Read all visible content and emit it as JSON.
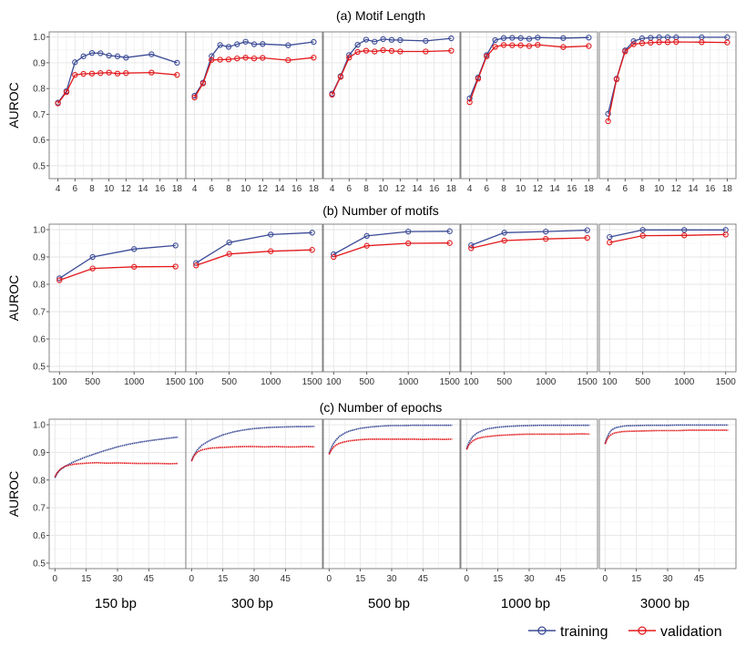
{
  "colors": {
    "training": "#3b4b96",
    "validation": "#e3191c",
    "grid": "#e6e6e6",
    "frame": "#777777"
  },
  "legend": {
    "training": "training",
    "validation": "validation"
  },
  "group_labels": [
    "150 bp",
    "300 bp",
    "500 bp",
    "1000 bp",
    "3000 bp"
  ],
  "chart_data": [
    {
      "type": "line",
      "title": "(a)  Motif Length",
      "ylabel": "AUROC",
      "ylim": [
        0.45,
        1.02
      ],
      "yticks": [
        0.5,
        0.6,
        0.7,
        0.8,
        0.9,
        1.0
      ],
      "xlim": [
        3.4,
        18.6
      ],
      "xticks": [
        4,
        6,
        8,
        10,
        12,
        14,
        16,
        18
      ],
      "markers": true,
      "facets": [
        {
          "x": [
            4,
            5,
            6,
            7,
            8,
            9,
            10,
            11,
            12,
            15,
            18
          ],
          "training": [
            0.745,
            0.79,
            0.902,
            0.925,
            0.938,
            0.937,
            0.928,
            0.925,
            0.92,
            0.933,
            0.9
          ],
          "validation": [
            0.742,
            0.786,
            0.853,
            0.857,
            0.858,
            0.86,
            0.862,
            0.858,
            0.86,
            0.862,
            0.853
          ]
        },
        {
          "x": [
            4,
            5,
            6,
            7,
            8,
            9,
            10,
            11,
            12,
            15,
            18
          ],
          "training": [
            0.772,
            0.823,
            0.926,
            0.969,
            0.962,
            0.972,
            0.982,
            0.972,
            0.973,
            0.968,
            0.981
          ],
          "validation": [
            0.765,
            0.82,
            0.911,
            0.912,
            0.913,
            0.917,
            0.92,
            0.917,
            0.919,
            0.91,
            0.92
          ]
        },
        {
          "x": [
            4,
            5,
            6,
            7,
            8,
            9,
            10,
            11,
            12,
            15,
            18
          ],
          "training": [
            0.78,
            0.848,
            0.93,
            0.97,
            0.99,
            0.982,
            0.992,
            0.989,
            0.988,
            0.985,
            0.995
          ],
          "validation": [
            0.776,
            0.845,
            0.92,
            0.942,
            0.947,
            0.944,
            0.949,
            0.946,
            0.944,
            0.944,
            0.947
          ]
        },
        {
          "x": [
            4,
            5,
            6,
            7,
            8,
            9,
            10,
            11,
            12,
            15,
            18
          ],
          "training": [
            0.762,
            0.843,
            0.93,
            0.988,
            0.996,
            0.997,
            0.996,
            0.993,
            0.998,
            0.996,
            0.998
          ],
          "validation": [
            0.747,
            0.838,
            0.925,
            0.962,
            0.969,
            0.968,
            0.968,
            0.965,
            0.97,
            0.961,
            0.965
          ]
        },
        {
          "x": [
            4,
            5,
            6,
            7,
            8,
            9,
            10,
            11,
            12,
            15,
            18
          ],
          "training": [
            0.702,
            0.838,
            0.948,
            0.984,
            0.995,
            0.997,
            0.999,
            0.999,
            0.999,
            0.999,
            0.999
          ],
          "validation": [
            0.673,
            0.836,
            0.944,
            0.972,
            0.976,
            0.978,
            0.98,
            0.98,
            0.981,
            0.98,
            0.979
          ]
        }
      ]
    },
    {
      "type": "line",
      "title": "(b)  Number of motifs",
      "ylabel": "AUROC",
      "ylim": [
        0.48,
        1.02
      ],
      "yticks": [
        0.5,
        0.6,
        0.7,
        0.8,
        0.9,
        1.0
      ],
      "xlim": [
        20,
        1580
      ],
      "xticks": [
        100,
        500,
        1000,
        1500
      ],
      "markers": true,
      "facets": [
        {
          "x": [
            100,
            500,
            1000,
            1500
          ],
          "training": [
            0.822,
            0.9,
            0.929,
            0.942
          ],
          "validation": [
            0.815,
            0.858,
            0.864,
            0.865
          ]
        },
        {
          "x": [
            100,
            500,
            1000,
            1500
          ],
          "training": [
            0.878,
            0.953,
            0.982,
            0.989
          ],
          "validation": [
            0.869,
            0.911,
            0.921,
            0.926
          ]
        },
        {
          "x": [
            100,
            500,
            1000,
            1500
          ],
          "training": [
            0.91,
            0.977,
            0.993,
            0.994
          ],
          "validation": [
            0.9,
            0.941,
            0.95,
            0.951
          ]
        },
        {
          "x": [
            100,
            500,
            1000,
            1500
          ],
          "training": [
            0.943,
            0.989,
            0.993,
            0.998
          ],
          "validation": [
            0.932,
            0.96,
            0.966,
            0.97
          ]
        },
        {
          "x": [
            100,
            500,
            1000,
            1500
          ],
          "training": [
            0.973,
            0.999,
            0.999,
            0.999
          ],
          "validation": [
            0.953,
            0.978,
            0.979,
            0.982
          ]
        }
      ]
    },
    {
      "type": "line",
      "title": "(c)  Number of epochs",
      "ylabel": "AUROC",
      "ylim": [
        0.48,
        1.02
      ],
      "yticks": [
        0.5,
        0.6,
        0.7,
        0.8,
        0.9,
        1.0
      ],
      "xlim": [
        -1,
        61
      ],
      "xticks": [
        0,
        15,
        30,
        45
      ],
      "markers": false,
      "facets": [
        {
          "x": [
            0,
            1,
            2,
            3,
            5,
            8,
            10,
            15,
            20,
            25,
            30,
            35,
            40,
            45,
            50,
            55,
            59
          ],
          "training": [
            0.808,
            0.823,
            0.833,
            0.84,
            0.85,
            0.862,
            0.869,
            0.884,
            0.897,
            0.909,
            0.92,
            0.929,
            0.936,
            0.942,
            0.947,
            0.952,
            0.955
          ],
          "validation": [
            0.812,
            0.826,
            0.835,
            0.842,
            0.85,
            0.856,
            0.858,
            0.861,
            0.863,
            0.861,
            0.862,
            0.861,
            0.86,
            0.86,
            0.86,
            0.859,
            0.86
          ]
        },
        {
          "x": [
            0,
            1,
            2,
            3,
            5,
            8,
            10,
            15,
            20,
            25,
            30,
            35,
            40,
            45,
            50,
            55,
            59
          ],
          "training": [
            0.87,
            0.888,
            0.9,
            0.911,
            0.926,
            0.94,
            0.948,
            0.963,
            0.974,
            0.981,
            0.986,
            0.989,
            0.991,
            0.992,
            0.993,
            0.993,
            0.994
          ],
          "validation": [
            0.868,
            0.885,
            0.895,
            0.902,
            0.909,
            0.914,
            0.916,
            0.918,
            0.92,
            0.921,
            0.921,
            0.92,
            0.921,
            0.92,
            0.92,
            0.921,
            0.92
          ]
        },
        {
          "x": [
            0,
            1,
            2,
            3,
            5,
            8,
            10,
            15,
            20,
            25,
            30,
            35,
            40,
            45,
            50,
            55,
            59
          ],
          "training": [
            0.896,
            0.915,
            0.931,
            0.942,
            0.958,
            0.972,
            0.978,
            0.987,
            0.992,
            0.995,
            0.997,
            0.997,
            0.998,
            0.998,
            0.998,
            0.998,
            0.998
          ],
          "validation": [
            0.893,
            0.907,
            0.918,
            0.925,
            0.933,
            0.939,
            0.942,
            0.946,
            0.948,
            0.948,
            0.948,
            0.948,
            0.948,
            0.947,
            0.948,
            0.947,
            0.948
          ]
        },
        {
          "x": [
            0,
            1,
            2,
            3,
            5,
            8,
            10,
            15,
            20,
            25,
            30,
            35,
            40,
            45,
            50,
            55,
            59
          ],
          "training": [
            0.913,
            0.934,
            0.947,
            0.958,
            0.97,
            0.98,
            0.985,
            0.991,
            0.994,
            0.996,
            0.997,
            0.998,
            0.998,
            0.998,
            0.998,
            0.998,
            0.998
          ],
          "validation": [
            0.91,
            0.926,
            0.935,
            0.942,
            0.95,
            0.955,
            0.957,
            0.961,
            0.963,
            0.965,
            0.966,
            0.966,
            0.966,
            0.966,
            0.966,
            0.967,
            0.966
          ]
        },
        {
          "x": [
            0,
            1,
            2,
            3,
            5,
            8,
            10,
            15,
            20,
            25,
            30,
            35,
            40,
            45,
            50,
            55,
            59
          ],
          "training": [
            0.932,
            0.955,
            0.97,
            0.98,
            0.989,
            0.994,
            0.996,
            0.997,
            0.998,
            0.998,
            0.998,
            0.999,
            0.999,
            0.999,
            0.999,
            0.999,
            0.999
          ],
          "validation": [
            0.93,
            0.948,
            0.958,
            0.965,
            0.971,
            0.975,
            0.976,
            0.977,
            0.978,
            0.979,
            0.979,
            0.979,
            0.98,
            0.98,
            0.98,
            0.98,
            0.98
          ]
        }
      ]
    }
  ]
}
